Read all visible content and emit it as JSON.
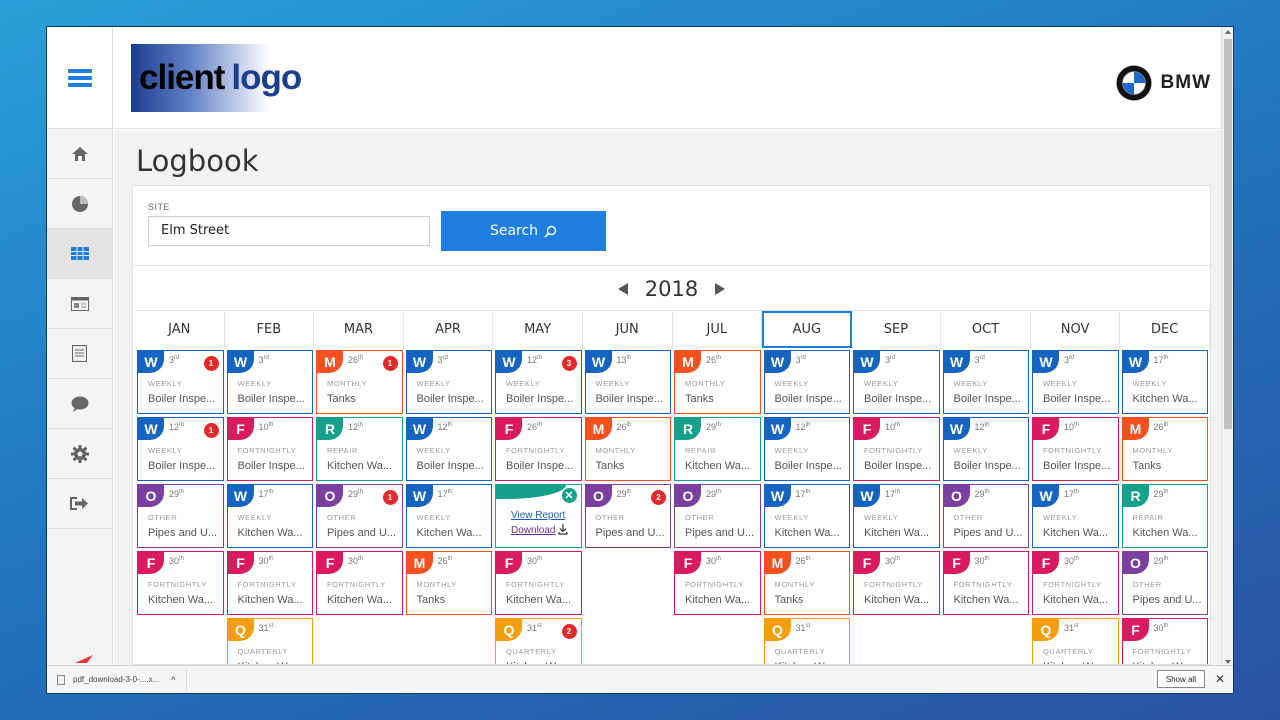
{
  "header": {
    "logo_part1": "client",
    "logo_part2": "logo",
    "brand": "BMW"
  },
  "sidebar": {
    "items": [
      {
        "icon": "home-icon"
      },
      {
        "icon": "pie-chart-icon"
      },
      {
        "icon": "table-icon",
        "active": true
      },
      {
        "icon": "dashboard-icon"
      },
      {
        "icon": "document-icon"
      },
      {
        "icon": "chat-icon"
      },
      {
        "icon": "gear-icon"
      },
      {
        "icon": "logout-icon"
      }
    ]
  },
  "page": {
    "title": "Logbook"
  },
  "filter": {
    "site_label": "SITE",
    "site_value": "Elm Street",
    "search_label": "Search"
  },
  "calendar": {
    "year": "2018",
    "selected_month": "AUG",
    "months": [
      "JAN",
      "FEB",
      "MAR",
      "APR",
      "MAY",
      "JUN",
      "JUL",
      "AUG",
      "SEP",
      "OCT",
      "NOV",
      "DEC"
    ],
    "colors": {
      "W": "#1565c0",
      "F": "#d81b60",
      "M": "#f4511e",
      "R": "#14a08a",
      "O": "#7b3fa0",
      "Q": "#f59e0b"
    },
    "rows": [
      [
        {
          "t": "W",
          "d": "3",
          "s": "rd",
          "f": "WEEKLY",
          "n": "Boiler Inspe...",
          "b": "1"
        },
        {
          "t": "W",
          "d": "3",
          "s": "rd",
          "f": "WEEKLY",
          "n": "Boiler Inspe..."
        },
        {
          "t": "M",
          "d": "26",
          "s": "th",
          "f": "MONTHLY",
          "n": "Tanks",
          "b": "1"
        },
        {
          "t": "W",
          "d": "3",
          "s": "rd",
          "f": "WEEKLY",
          "n": "Boiler Inspe..."
        },
        {
          "t": "W",
          "d": "12",
          "s": "th",
          "f": "WEEKLY",
          "n": "Boiler Inspe...",
          "b": "3"
        },
        {
          "t": "W",
          "d": "13",
          "s": "th",
          "f": "WEEKLY",
          "n": "Boiler Inspe..."
        },
        {
          "t": "M",
          "d": "26",
          "s": "th",
          "f": "MONTHLY",
          "n": "Tanks"
        },
        {
          "t": "W",
          "d": "3",
          "s": "rd",
          "f": "WEEKLY",
          "n": "Boiler Inspe..."
        },
        {
          "t": "W",
          "d": "3",
          "s": "rd",
          "f": "WEEKLY",
          "n": "Boiler Inspe..."
        },
        {
          "t": "W",
          "d": "3",
          "s": "rd",
          "f": "WEEKLY",
          "n": "Boiler Inspe..."
        },
        {
          "t": "W",
          "d": "3",
          "s": "rd",
          "f": "WEEKLY",
          "n": "Boiler Inspe..."
        },
        {
          "t": "W",
          "d": "17",
          "s": "th",
          "f": "WEEKLY",
          "n": "Kitchen Wa..."
        }
      ],
      [
        {
          "t": "W",
          "d": "12",
          "s": "th",
          "f": "WEEKLY",
          "n": "Boiler Inspe...",
          "b": "1"
        },
        {
          "t": "F",
          "d": "10",
          "s": "th",
          "f": "FORTNIGHTLY",
          "n": "Boiler Inspe..."
        },
        {
          "t": "R",
          "d": "12",
          "s": "th",
          "f": "REPAIR",
          "n": "Kitchen Wa..."
        },
        {
          "t": "W",
          "d": "12",
          "s": "th",
          "f": "WEEKLY",
          "n": "Boiler Inspe..."
        },
        {
          "t": "F",
          "d": "26",
          "s": "th",
          "f": "FORTNIGHTLY",
          "n": "Boiler Inspe..."
        },
        {
          "t": "M",
          "d": "26",
          "s": "th",
          "f": "MONTHLY",
          "n": "Tanks"
        },
        {
          "t": "R",
          "d": "29",
          "s": "th",
          "f": "REPAIR",
          "n": "Kitchen Wa..."
        },
        {
          "t": "W",
          "d": "12",
          "s": "th",
          "f": "WEEKLY",
          "n": "Boiler Inspe..."
        },
        {
          "t": "F",
          "d": "10",
          "s": "th",
          "f": "FORTNIGHTLY",
          "n": "Boiler Inspe..."
        },
        {
          "t": "W",
          "d": "12",
          "s": "th",
          "f": "WEEKLY",
          "n": "Boiler Inspe..."
        },
        {
          "t": "F",
          "d": "10",
          "s": "th",
          "f": "FORTNIGHTLY",
          "n": "Boiler Inspe..."
        },
        {
          "t": "M",
          "d": "26",
          "s": "th",
          "f": "MONTHLY",
          "n": "Tanks"
        }
      ],
      [
        {
          "t": "O",
          "d": "29",
          "s": "th",
          "f": "OTHER",
          "n": "Pipes and U..."
        },
        {
          "t": "W",
          "d": "17",
          "s": "th",
          "f": "WEEKLY",
          "n": "Kitchen Wa..."
        },
        {
          "t": "O",
          "d": "29",
          "s": "th",
          "f": "OTHER",
          "n": "Pipes and U...",
          "b": "1"
        },
        {
          "t": "W",
          "d": "17",
          "s": "th",
          "f": "WEEKLY",
          "n": "Kitchen Wa..."
        },
        {
          "popup": true,
          "view": "View Report",
          "download": "Download"
        },
        {
          "t": "O",
          "d": "29",
          "s": "th",
          "f": "OTHER",
          "n": "Pipes and U...",
          "b": "2"
        },
        {
          "t": "O",
          "d": "29",
          "s": "th",
          "f": "OTHER",
          "n": "Pipes and U..."
        },
        {
          "t": "W",
          "d": "17",
          "s": "th",
          "f": "WEEKLY",
          "n": "Kitchen Wa..."
        },
        {
          "t": "W",
          "d": "17",
          "s": "th",
          "f": "WEEKLY",
          "n": "Kitchen Wa..."
        },
        {
          "t": "O",
          "d": "29",
          "s": "th",
          "f": "OTHER",
          "n": "Pipes and U..."
        },
        {
          "t": "W",
          "d": "17",
          "s": "th",
          "f": "WEEKLY",
          "n": "Kitchen Wa..."
        },
        {
          "t": "R",
          "d": "29",
          "s": "th",
          "f": "REPAIR",
          "n": "Kitchen Wa..."
        }
      ],
      [
        {
          "t": "F",
          "d": "30",
          "s": "th",
          "f": "FORTNIGHTLY",
          "n": "Kitchen Wa..."
        },
        {
          "t": "F",
          "d": "30",
          "s": "th",
          "f": "FORTNIGHTLY",
          "n": "Kitchen Wa..."
        },
        {
          "t": "F",
          "d": "30",
          "s": "th",
          "f": "FORTNIGHTLY",
          "n": "Kitchen Wa..."
        },
        {
          "t": "M",
          "d": "26",
          "s": "th",
          "f": "MONTHLY",
          "n": "Tanks"
        },
        {
          "t": "F",
          "d": "30",
          "s": "th",
          "f": "FORTNIGHTLY",
          "n": "Kitchen Wa..."
        },
        null,
        {
          "t": "F",
          "d": "30",
          "s": "th",
          "f": "FORTNIGHTLY",
          "n": "Kitchen Wa..."
        },
        {
          "t": "M",
          "d": "26",
          "s": "th",
          "f": "MONTHLY",
          "n": "Tanks"
        },
        {
          "t": "F",
          "d": "30",
          "s": "th",
          "f": "FORTNIGHTLY",
          "n": "Kitchen Wa..."
        },
        {
          "t": "F",
          "d": "30",
          "s": "th",
          "f": "FORTNIGHTLY",
          "n": "Kitchen Wa..."
        },
        {
          "t": "F",
          "d": "30",
          "s": "th",
          "f": "FORTNIGHTLY",
          "n": "Kitchen Wa..."
        },
        {
          "t": "O",
          "d": "29",
          "s": "th",
          "f": "OTHER",
          "n": "Pipes and U..."
        }
      ],
      [
        null,
        {
          "t": "Q",
          "d": "31",
          "s": "st",
          "f": "QUARTERLY",
          "n": "Kitchen Wa..."
        },
        null,
        null,
        {
          "t": "Q",
          "d": "31",
          "s": "st",
          "f": "QUARTERLY",
          "n": "Kitchen Wa...",
          "b": "2"
        },
        null,
        null,
        {
          "t": "Q",
          "d": "31",
          "s": "st",
          "f": "QUARTERLY",
          "n": "Kitchen Wa..."
        },
        null,
        null,
        {
          "t": "Q",
          "d": "31",
          "s": "st",
          "f": "QUARTERLY",
          "n": "Kitchen Wa..."
        },
        {
          "t": "F",
          "d": "30",
          "s": "th",
          "f": "FORTNIGHTLY",
          "n": "Kitchen Wa..."
        }
      ]
    ]
  },
  "downloads": {
    "file_name": "pdf_download-3-0-....x...",
    "show_all": "Show all",
    "close": "✕"
  }
}
